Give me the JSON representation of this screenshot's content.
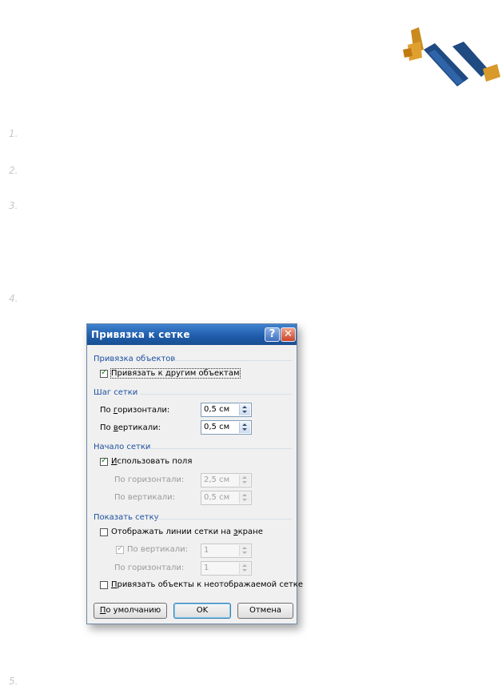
{
  "list_numbers": [
    "1.",
    "2.",
    "3.",
    "4.",
    "5."
  ],
  "logo_icon": "pencil-ruler-logo-icon",
  "dialog": {
    "title": "Привязка к сетке",
    "help_icon": "?",
    "close_icon": "✕",
    "snap_section": {
      "title": "Привязка объектов",
      "snap_to_objects": {
        "label": "Привязать к другим объектам",
        "checked": true
      }
    },
    "grid_step_section": {
      "title": "Шаг сетки",
      "horizontal": {
        "label_pre": "По ",
        "label_key": "г",
        "label_post": "оризонтали:",
        "value": "0,5 см"
      },
      "vertical": {
        "label_pre": "По ",
        "label_key": "в",
        "label_post": "ертикали:",
        "value": "0,5 см"
      }
    },
    "grid_origin_section": {
      "title": "Начало сетки",
      "use_margins": {
        "label_key": "И",
        "label_post": "спользовать поля",
        "checked": true
      },
      "horizontal": {
        "label": "По горизонтали:",
        "value": "2,5 см"
      },
      "vertical": {
        "label": "По вертикали:",
        "value": "0,5 см"
      }
    },
    "show_grid_section": {
      "title": "Показать сетку",
      "display_gridlines": {
        "label_pre": "Отображать линии сетки на ",
        "label_key": "э",
        "label_post": "кране",
        "checked": false
      },
      "vertical_every": {
        "label": "По вертикали:",
        "value": "1",
        "checked": true
      },
      "horizontal_every": {
        "label": "По горизонтали:",
        "value": "1"
      },
      "snap_when_hidden": {
        "label_key": "П",
        "label_post": "ривязать объекты к неотображаемой сетке",
        "checked": false
      }
    },
    "buttons": {
      "default_key": "П",
      "default_post": "о умолчанию",
      "ok": "OK",
      "cancel": "Отмена"
    }
  },
  "colors": {
    "title_bar": "#1e5ba8",
    "section_title": "#1b4fa0",
    "checkmark": "#1b7a1b",
    "close_button": "#c9452a"
  }
}
